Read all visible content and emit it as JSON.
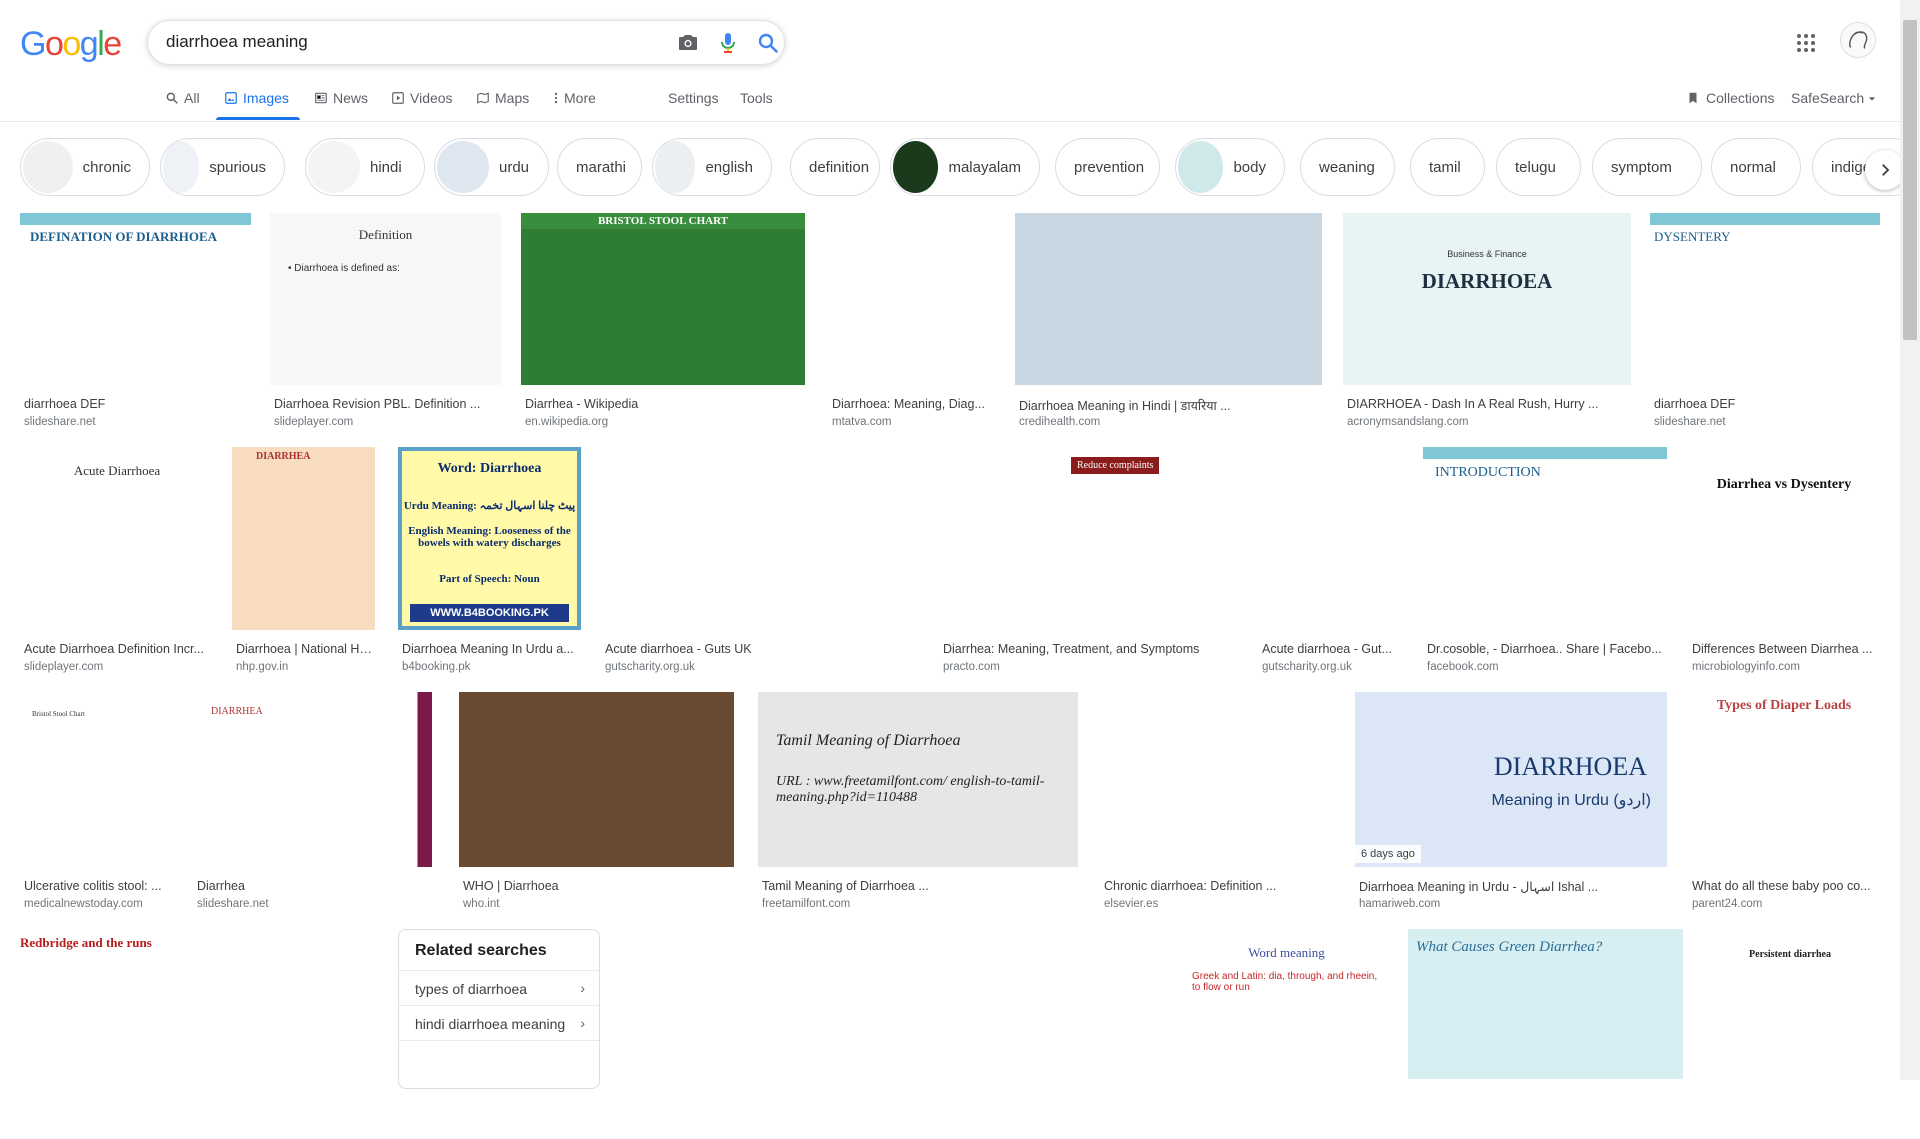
{
  "logo": {
    "letters": [
      "G",
      "o",
      "o",
      "g",
      "l",
      "e"
    ],
    "colors": [
      "#4285f4",
      "#ea4335",
      "#fbbc05",
      "#4285f4",
      "#34a853",
      "#ea4335"
    ]
  },
  "search": {
    "query": "diarrhoea meaning"
  },
  "tabs": [
    {
      "label": "All",
      "icon": "search-icon"
    },
    {
      "label": "Images",
      "icon": "image-icon",
      "active": true
    },
    {
      "label": "News",
      "icon": "news-icon"
    },
    {
      "label": "Videos",
      "icon": "video-icon"
    },
    {
      "label": "Maps",
      "icon": "map-icon"
    },
    {
      "label": "More",
      "icon": "more-vert-icon"
    },
    {
      "label": "Settings"
    },
    {
      "label": "Tools"
    }
  ],
  "right_tools": {
    "collections": "Collections",
    "safesearch": "SafeSearch"
  },
  "chips": [
    "chronic",
    "spurious",
    "hindi",
    "urdu",
    "marathi",
    "english",
    "definition",
    "malayalam",
    "prevention",
    "body",
    "weaning",
    "tamil",
    "telugu",
    "symptom",
    "normal",
    "indigestion"
  ],
  "results": [
    {
      "title": "diarrhoea DEF",
      "source": "slideshare.net",
      "overlay": "DEFINATION OF DIARRHOEA"
    },
    {
      "title": "Diarrhoea Revision PBL. Definition ...",
      "source": "slideplayer.com",
      "overlay": "Definition"
    },
    {
      "title": "Diarrhea - Wikipedia",
      "source": "en.wikipedia.org",
      "overlay": "BRISTOL STOOL CHART"
    },
    {
      "title": "Diarrhoea: Meaning, Diag...",
      "source": "mtatva.com",
      "overlay": ""
    },
    {
      "title": "Diarrhoea Meaning in Hindi | डायरिया ...",
      "source": "credihealth.com",
      "overlay": ""
    },
    {
      "title": "DIARRHOEA - Dash In A Real Rush, Hurry ...",
      "source": "acronymsandslang.com",
      "overlay": "DIARRHOEA"
    },
    {
      "title": "diarrhoea DEF",
      "source": "slideshare.net",
      "overlay": "DYSENTERY"
    },
    {
      "title": "Acute Diarrhoea Definition Incr...",
      "source": "slideplayer.com",
      "overlay": "Acute Diarrhoea"
    },
    {
      "title": "Diarrhoea | National He...",
      "source": "nhp.gov.in",
      "overlay": "DIARRHEA"
    },
    {
      "title": "Diarrhoea Meaning In Urdu a...",
      "source": "b4booking.pk",
      "overlay": "Word: Diarrhoea"
    },
    {
      "title": "Acute diarrhoea - Guts UK",
      "source": "gutscharity.org.uk",
      "overlay": ""
    },
    {
      "title": "Diarrhea: Meaning, Treatment, and Symptoms",
      "source": "practo.com",
      "overlay": "Reduce complaints"
    },
    {
      "title": "Acute diarrhoea - Gut...",
      "source": "gutscharity.org.uk",
      "overlay": ""
    },
    {
      "title": "Dr.cosoble, - Diarrhoea.. Share | Facebo...",
      "source": "facebook.com",
      "overlay": "INTRODUCTION"
    },
    {
      "title": "Differences Between Diarrhea ...",
      "source": "microbiologyinfo.com",
      "overlay": "Diarrhea vs Dysentery"
    },
    {
      "title": "Ulcerative colitis stool: ...",
      "source": "medicalnewstoday.com",
      "overlay": "Bristol Stool Chart"
    },
    {
      "title": "Diarrhea",
      "source": "slideshare.net",
      "overlay": "DIARRHEA"
    },
    {
      "title": "WHO | Diarrhoea",
      "source": "who.int",
      "overlay": ""
    },
    {
      "title": "Tamil Meaning of Diarrhoea ...",
      "source": "freetamilfont.com",
      "overlay": "Tamil Meaning of Diarrhoea"
    },
    {
      "title": "Chronic diarrhoea: Definition ...",
      "source": "elsevier.es",
      "overlay": ""
    },
    {
      "title": "Diarrhoea Meaning in Urdu - اسہال Ishal ...",
      "source": "hamariweb.com",
      "overlay": "DIARRHOEA",
      "badge": "6 days ago"
    },
    {
      "title": "What do all these baby poo co...",
      "source": "parent24.com",
      "overlay": "Types of Diaper Loads"
    },
    {
      "title": "",
      "source": "",
      "overlay": "Redbridge and the runs"
    },
    {
      "title": "",
      "source": "",
      "overlay": ""
    },
    {
      "title": "",
      "source": "",
      "overlay": ""
    },
    {
      "title": "",
      "source": "",
      "overlay": ""
    },
    {
      "title": "",
      "source": "",
      "overlay": "Word meaning"
    },
    {
      "title": "",
      "source": "",
      "overlay": "What Causes Green Diarrhea?"
    },
    {
      "title": "",
      "source": "",
      "overlay": "Persistent diarrhea"
    }
  ],
  "overlay_extra": {
    "def_bullets": "• Diarrhoea is defined as:",
    "tamil_url": "URL : www.freetamilfont.com/ english-to-tamil-meaning.php?id=110488",
    "urdu_sub": "Meaning in Urdu (اردو)",
    "b4_site": "WWW.B4BOOKING.PK",
    "b4_urdu": "Urdu Meaning: پیٹ چلنا اسہال تخمہ",
    "b4_eng": "English Meaning: Looseness of the bowels with watery discharges",
    "b4_pos": "Part of Speech: Noun",
    "dash_sub": "Business & Finance",
    "greek": "Greek and Latin: dia, through, and rheein, to flow or run"
  },
  "related": {
    "heading": "Related searches",
    "items": [
      "types of diarrhoea",
      "hindi diarrhoea meaning"
    ]
  }
}
